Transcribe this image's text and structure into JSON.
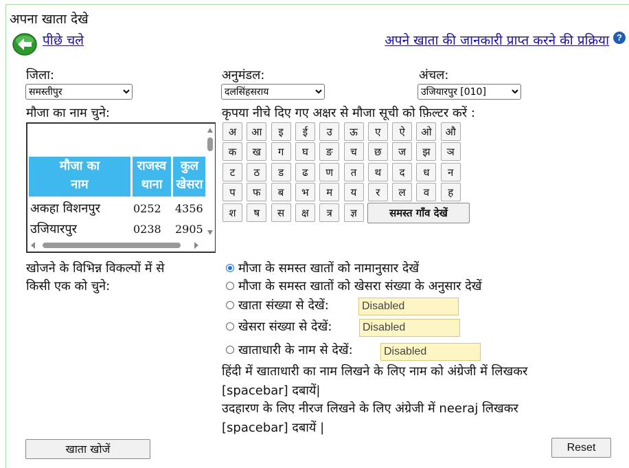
{
  "page": {
    "title": "अपना खाता देखे"
  },
  "nav": {
    "back_label": "पीछे चले",
    "process_link": "अपने खाता की जानकारी प्राप्त करने की प्रक्रिया",
    "help_glyph": "?"
  },
  "filters": {
    "district_label": "जिला:",
    "district_value": "समस्तीपुर",
    "subdivision_label": "अनुमंडल:",
    "subdivision_value": "दलसिंहसराय",
    "circle_label": "अंचल:",
    "circle_value": "उजियारपुर [010]"
  },
  "mouza": {
    "label": "मौजा का नाम चुने:",
    "columns": [
      "मौजा का नाम",
      "राजस्व थाना",
      "कुल खेसरा"
    ],
    "columns_display": [
      "मौजा का\nनाम",
      "राजस्व\nथाना",
      "कुल\nखेसरा"
    ],
    "rows": [
      {
        "name": "अकहा विशनपुर",
        "thana": "0252",
        "khesra": "4356"
      },
      {
        "name": "उजियारपुर",
        "thana": "0238",
        "khesra": "2905"
      }
    ]
  },
  "keyboard": {
    "instruction": "कृपया नीचे दिए गए अक्षर से मौजा सूची को फ़िल्टर करें :",
    "rows": [
      [
        "अ",
        "आ",
        "इ",
        "ई",
        "उ",
        "ऊ",
        "ए",
        "ऐ",
        "ओ",
        "औ"
      ],
      [
        "क",
        "ख",
        "ग",
        "घ",
        "ङ",
        "च",
        "छ",
        "ज",
        "झ",
        "ञ"
      ],
      [
        "ट",
        "ठ",
        "ड",
        "ढ",
        "ण",
        "त",
        "थ",
        "द",
        "ध",
        "न"
      ],
      [
        "प",
        "फ",
        "ब",
        "भ",
        "म",
        "य",
        "र",
        "ल",
        "व",
        "ह"
      ],
      [
        "श",
        "ष",
        "स",
        "क्ष",
        "त्र",
        "ज्ञ"
      ]
    ],
    "all_villages_label": "समस्त गाँव देखें"
  },
  "search": {
    "label_line1": "खोजने के विभिन्न विकल्पों में से",
    "label_line2": "किसी एक को चुने:",
    "options": [
      {
        "label": "मौजा के समस्त खातों को नामानुसार देखें",
        "selected": true
      },
      {
        "label": "मौजा के समस्त खातों को खेसरा संख्या के अनुसार देखें",
        "selected": false
      },
      {
        "label": "खाता संख्या से देखें:",
        "selected": false,
        "input": "Disabled"
      },
      {
        "label": "खेसरा संख्या से देखें:",
        "selected": false,
        "input": "Disabled"
      },
      {
        "label": "खाताधारी के नाम से देखें:",
        "selected": false,
        "input": "Disabled"
      }
    ]
  },
  "hint": {
    "line1": "हिंदी में खाताधारी का नाम लिखने के लिए नाम को अंग्रेजी में लिखकर",
    "line2": "[spacebar] दबायें|",
    "line3": "उदहारण के लिए नीरज लिखने के लिए अंग्रेजी में neeraj लिखकर",
    "line4": "[spacebar] दबायें |"
  },
  "actions": {
    "search_label": "खाता खोजें",
    "reset_label": "Reset"
  },
  "colors": {
    "accent": "#3fb8ee",
    "link": "#1a0dab",
    "input_bg": "#fdf6c4"
  }
}
